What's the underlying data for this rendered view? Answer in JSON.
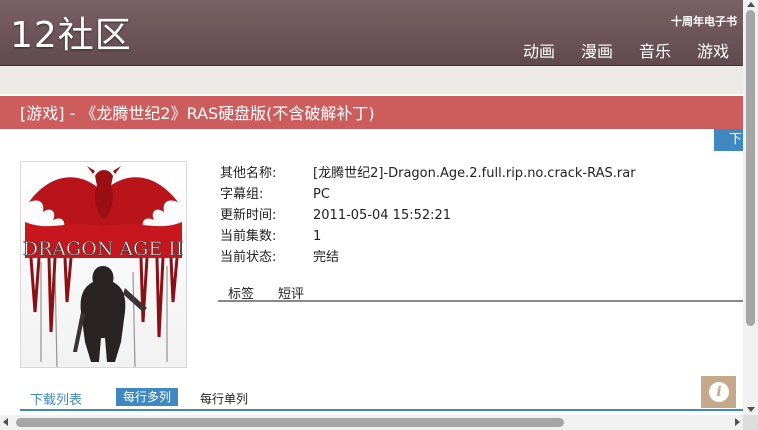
{
  "header": {
    "logo": "12社区",
    "top_link": "十周年电子书",
    "nav": [
      "动画",
      "漫画",
      "音乐",
      "游戏"
    ]
  },
  "title": "[游戏] - 《龙腾世纪2》RAS硬盘版(不含破解补丁)",
  "download_tab": "下",
  "cover": {
    "alt_text": "DRAGON AGE II",
    "icon": "dragon-age-cover-image"
  },
  "info": [
    {
      "label": "其他名称:",
      "value": "[龙腾世纪2]-Dragon.Age.2.full.rip.no.crack-RAS.rar"
    },
    {
      "label": "字幕组:",
      "value": "PC"
    },
    {
      "label": "更新时间:",
      "value": "2011-05-04 15:52:21"
    },
    {
      "label": "当前集数:",
      "value": "1"
    },
    {
      "label": "当前状态:",
      "value": "完结"
    }
  ],
  "subtabs": [
    "标签",
    "短评"
  ],
  "bottom_tabs": {
    "list": "下载列表",
    "multi": "每行多列",
    "single": "每行单列"
  },
  "info_badge": "i",
  "colors": {
    "header": "#6b5459",
    "title_bar": "#cd5c5c",
    "accent": "#3f88c1",
    "badge": "#c6a98a"
  }
}
